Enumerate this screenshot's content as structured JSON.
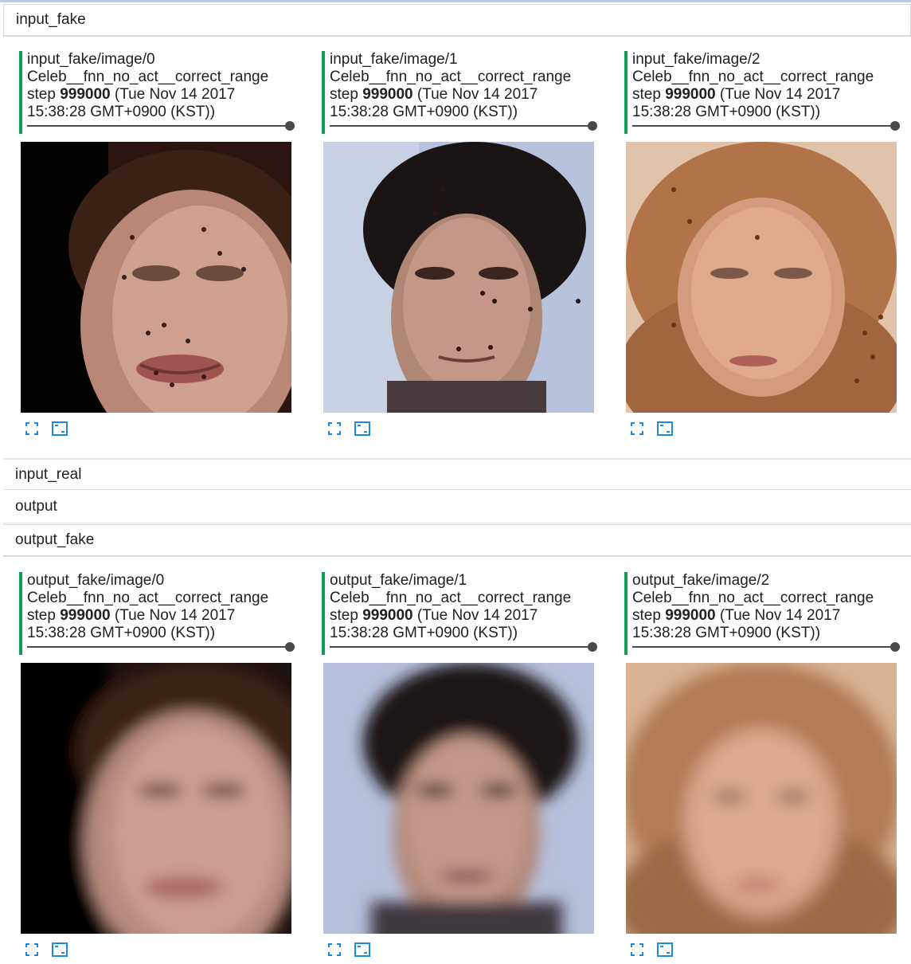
{
  "sections": [
    {
      "title": "input_fake",
      "expanded": true,
      "cards": [
        {
          "tag": "input_fake/image/0",
          "run": "Celeb__fnn_no_act__correct_range",
          "step_prefix": "step ",
          "step": "999000",
          "time_line1": " (Tue Nov 14 2017",
          "time_line2": "15:38:28 GMT+0900 (KST))"
        },
        {
          "tag": "input_fake/image/1",
          "run": "Celeb__fnn_no_act__correct_range",
          "step_prefix": "step ",
          "step": "999000",
          "time_line1": " (Tue Nov 14 2017",
          "time_line2": "15:38:28 GMT+0900 (KST))"
        },
        {
          "tag": "input_fake/image/2",
          "run": "Celeb__fnn_no_act__correct_range",
          "step_prefix": "step ",
          "step": "999000",
          "time_line1": " (Tue Nov 14 2017",
          "time_line2": "15:38:28 GMT+0900 (KST))"
        }
      ]
    },
    {
      "title": "input_real",
      "expanded": false
    },
    {
      "title": "output",
      "expanded": false
    },
    {
      "title": "output_fake",
      "expanded": true,
      "cards": [
        {
          "tag": "output_fake/image/0",
          "run": "Celeb__fnn_no_act__correct_range",
          "step_prefix": "step ",
          "step": "999000",
          "time_line1": " (Tue Nov 14 2017",
          "time_line2": "15:38:28 GMT+0900 (KST))"
        },
        {
          "tag": "output_fake/image/1",
          "run": "Celeb__fnn_no_act__correct_range",
          "step_prefix": "step ",
          "step": "999000",
          "time_line1": " (Tue Nov 14 2017",
          "time_line2": "15:38:28 GMT+0900 (KST))"
        },
        {
          "tag": "output_fake/image/2",
          "run": "Celeb__fnn_no_act__correct_range",
          "step_prefix": "step ",
          "step": "999000",
          "time_line1": " (Tue Nov 14 2017",
          "time_line2": "15:38:28 GMT+0900 (KST))"
        }
      ]
    }
  ],
  "icons": {
    "expand": "fullscreen-icon",
    "actual_size": "actual-size-icon"
  },
  "colors": {
    "accent": "#0f9d58",
    "icon": "#1e88e5"
  }
}
